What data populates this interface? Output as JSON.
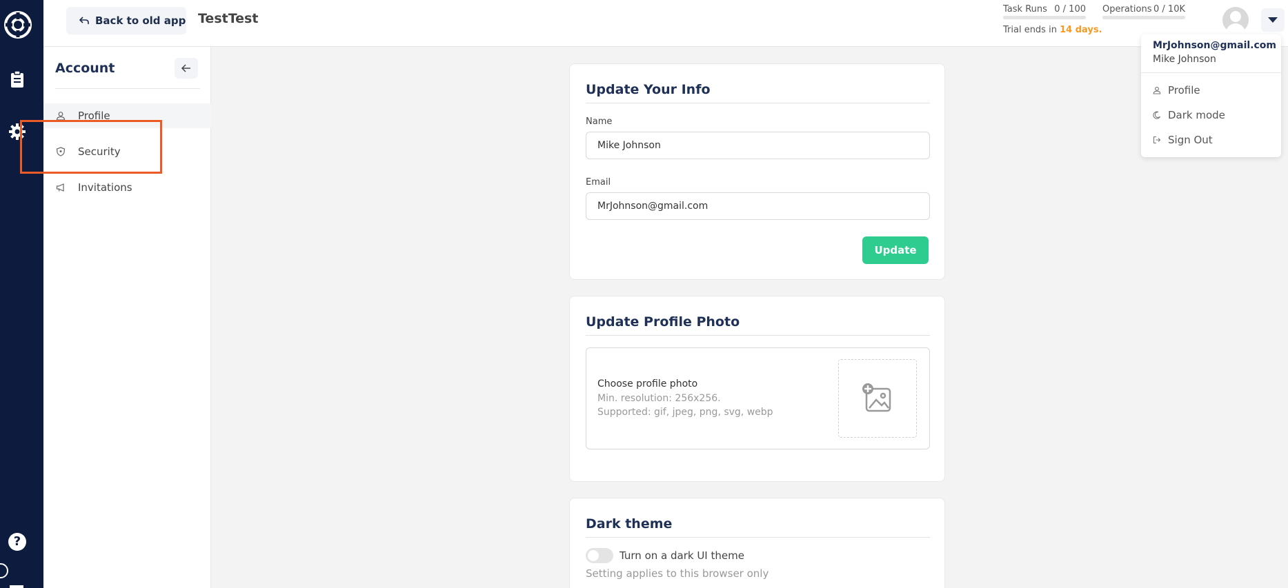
{
  "topbar": {
    "back_label": "Back to old app",
    "app_title": "TestTest",
    "task_runs": {
      "label": "Task Runs",
      "value": "0 / 100"
    },
    "operations": {
      "label": "Operations",
      "value": "0 / 10K"
    },
    "trial_prefix": "Trial ends in",
    "trial_days": "14 days."
  },
  "sidebar": {
    "heading": "Account",
    "items": [
      {
        "label": "Profile"
      },
      {
        "label": "Security"
      },
      {
        "label": "Invitations"
      }
    ]
  },
  "info_card": {
    "title": "Update Your Info",
    "name_label": "Name",
    "name_value": "Mike Johnson",
    "email_label": "Email",
    "email_value": "MrJohnson@gmail.com",
    "update_label": "Update"
  },
  "photo_card": {
    "title": "Update Profile Photo",
    "choose": "Choose profile photo",
    "min_res": "Min. resolution: 256x256.",
    "supported": "Supported: gif, jpeg, png, svg, webp"
  },
  "theme_card": {
    "title": "Dark theme",
    "toggle_label": "Turn on a dark UI theme",
    "note": "Setting applies to this browser only"
  },
  "dropdown": {
    "email": "MrJohnson@gmail.com",
    "name": "Mike Johnson",
    "items": [
      {
        "label": "Profile"
      },
      {
        "label": "Dark mode"
      },
      {
        "label": "Sign Out"
      }
    ]
  },
  "colors": {
    "rail": "#0d1b3e",
    "accent_green": "#2ecc8f",
    "trial_orange": "#f59a23",
    "highlight": "#ec5a25"
  }
}
